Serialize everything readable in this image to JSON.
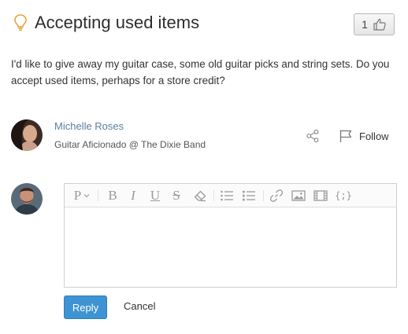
{
  "question": {
    "title": "Accepting used items",
    "body": "I'd like to give away my guitar case, some old guitar picks and string sets. Do you accept used items, perhaps for a store credit?",
    "like_count": "1"
  },
  "author": {
    "name": "Michelle Roses",
    "title": "Guitar Aficionado @ The Dixie Band"
  },
  "actions": {
    "follow_label": "Follow"
  },
  "editor": {
    "toolbar": {
      "paragraph_label": "P",
      "bold_label": "B",
      "italic_label": "I",
      "underline_label": "U",
      "strike_label": "S",
      "code_label": "{;}"
    },
    "reply_label": "Reply",
    "cancel_label": "Cancel"
  },
  "colors": {
    "accent": "#3e93d3",
    "link": "#5a7f9f",
    "idea": "#e8a33a"
  }
}
